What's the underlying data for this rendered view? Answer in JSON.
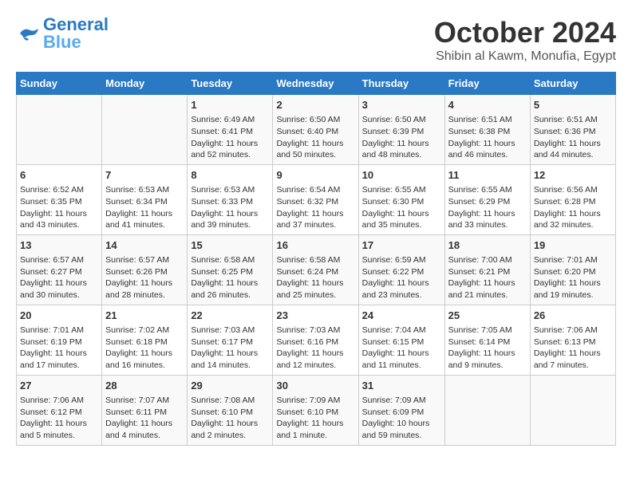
{
  "header": {
    "logo_general": "General",
    "logo_blue": "Blue",
    "month": "October 2024",
    "location": "Shibin al Kawm, Monufia, Egypt"
  },
  "weekdays": [
    "Sunday",
    "Monday",
    "Tuesday",
    "Wednesday",
    "Thursday",
    "Friday",
    "Saturday"
  ],
  "weeks": [
    [
      {
        "day": "",
        "info": ""
      },
      {
        "day": "",
        "info": ""
      },
      {
        "day": "1",
        "info": "Sunrise: 6:49 AM\nSunset: 6:41 PM\nDaylight: 11 hours\nand 52 minutes."
      },
      {
        "day": "2",
        "info": "Sunrise: 6:50 AM\nSunset: 6:40 PM\nDaylight: 11 hours\nand 50 minutes."
      },
      {
        "day": "3",
        "info": "Sunrise: 6:50 AM\nSunset: 6:39 PM\nDaylight: 11 hours\nand 48 minutes."
      },
      {
        "day": "4",
        "info": "Sunrise: 6:51 AM\nSunset: 6:38 PM\nDaylight: 11 hours\nand 46 minutes."
      },
      {
        "day": "5",
        "info": "Sunrise: 6:51 AM\nSunset: 6:36 PM\nDaylight: 11 hours\nand 44 minutes."
      }
    ],
    [
      {
        "day": "6",
        "info": "Sunrise: 6:52 AM\nSunset: 6:35 PM\nDaylight: 11 hours\nand 43 minutes."
      },
      {
        "day": "7",
        "info": "Sunrise: 6:53 AM\nSunset: 6:34 PM\nDaylight: 11 hours\nand 41 minutes."
      },
      {
        "day": "8",
        "info": "Sunrise: 6:53 AM\nSunset: 6:33 PM\nDaylight: 11 hours\nand 39 minutes."
      },
      {
        "day": "9",
        "info": "Sunrise: 6:54 AM\nSunset: 6:32 PM\nDaylight: 11 hours\nand 37 minutes."
      },
      {
        "day": "10",
        "info": "Sunrise: 6:55 AM\nSunset: 6:30 PM\nDaylight: 11 hours\nand 35 minutes."
      },
      {
        "day": "11",
        "info": "Sunrise: 6:55 AM\nSunset: 6:29 PM\nDaylight: 11 hours\nand 33 minutes."
      },
      {
        "day": "12",
        "info": "Sunrise: 6:56 AM\nSunset: 6:28 PM\nDaylight: 11 hours\nand 32 minutes."
      }
    ],
    [
      {
        "day": "13",
        "info": "Sunrise: 6:57 AM\nSunset: 6:27 PM\nDaylight: 11 hours\nand 30 minutes."
      },
      {
        "day": "14",
        "info": "Sunrise: 6:57 AM\nSunset: 6:26 PM\nDaylight: 11 hours\nand 28 minutes."
      },
      {
        "day": "15",
        "info": "Sunrise: 6:58 AM\nSunset: 6:25 PM\nDaylight: 11 hours\nand 26 minutes."
      },
      {
        "day": "16",
        "info": "Sunrise: 6:58 AM\nSunset: 6:24 PM\nDaylight: 11 hours\nand 25 minutes."
      },
      {
        "day": "17",
        "info": "Sunrise: 6:59 AM\nSunset: 6:22 PM\nDaylight: 11 hours\nand 23 minutes."
      },
      {
        "day": "18",
        "info": "Sunrise: 7:00 AM\nSunset: 6:21 PM\nDaylight: 11 hours\nand 21 minutes."
      },
      {
        "day": "19",
        "info": "Sunrise: 7:01 AM\nSunset: 6:20 PM\nDaylight: 11 hours\nand 19 minutes."
      }
    ],
    [
      {
        "day": "20",
        "info": "Sunrise: 7:01 AM\nSunset: 6:19 PM\nDaylight: 11 hours\nand 17 minutes."
      },
      {
        "day": "21",
        "info": "Sunrise: 7:02 AM\nSunset: 6:18 PM\nDaylight: 11 hours\nand 16 minutes."
      },
      {
        "day": "22",
        "info": "Sunrise: 7:03 AM\nSunset: 6:17 PM\nDaylight: 11 hours\nand 14 minutes."
      },
      {
        "day": "23",
        "info": "Sunrise: 7:03 AM\nSunset: 6:16 PM\nDaylight: 11 hours\nand 12 minutes."
      },
      {
        "day": "24",
        "info": "Sunrise: 7:04 AM\nSunset: 6:15 PM\nDaylight: 11 hours\nand 11 minutes."
      },
      {
        "day": "25",
        "info": "Sunrise: 7:05 AM\nSunset: 6:14 PM\nDaylight: 11 hours\nand 9 minutes."
      },
      {
        "day": "26",
        "info": "Sunrise: 7:06 AM\nSunset: 6:13 PM\nDaylight: 11 hours\nand 7 minutes."
      }
    ],
    [
      {
        "day": "27",
        "info": "Sunrise: 7:06 AM\nSunset: 6:12 PM\nDaylight: 11 hours\nand 5 minutes."
      },
      {
        "day": "28",
        "info": "Sunrise: 7:07 AM\nSunset: 6:11 PM\nDaylight: 11 hours\nand 4 minutes."
      },
      {
        "day": "29",
        "info": "Sunrise: 7:08 AM\nSunset: 6:10 PM\nDaylight: 11 hours\nand 2 minutes."
      },
      {
        "day": "30",
        "info": "Sunrise: 7:09 AM\nSunset: 6:10 PM\nDaylight: 11 hours\nand 1 minute."
      },
      {
        "day": "31",
        "info": "Sunrise: 7:09 AM\nSunset: 6:09 PM\nDaylight: 10 hours\nand 59 minutes."
      },
      {
        "day": "",
        "info": ""
      },
      {
        "day": "",
        "info": ""
      }
    ]
  ]
}
